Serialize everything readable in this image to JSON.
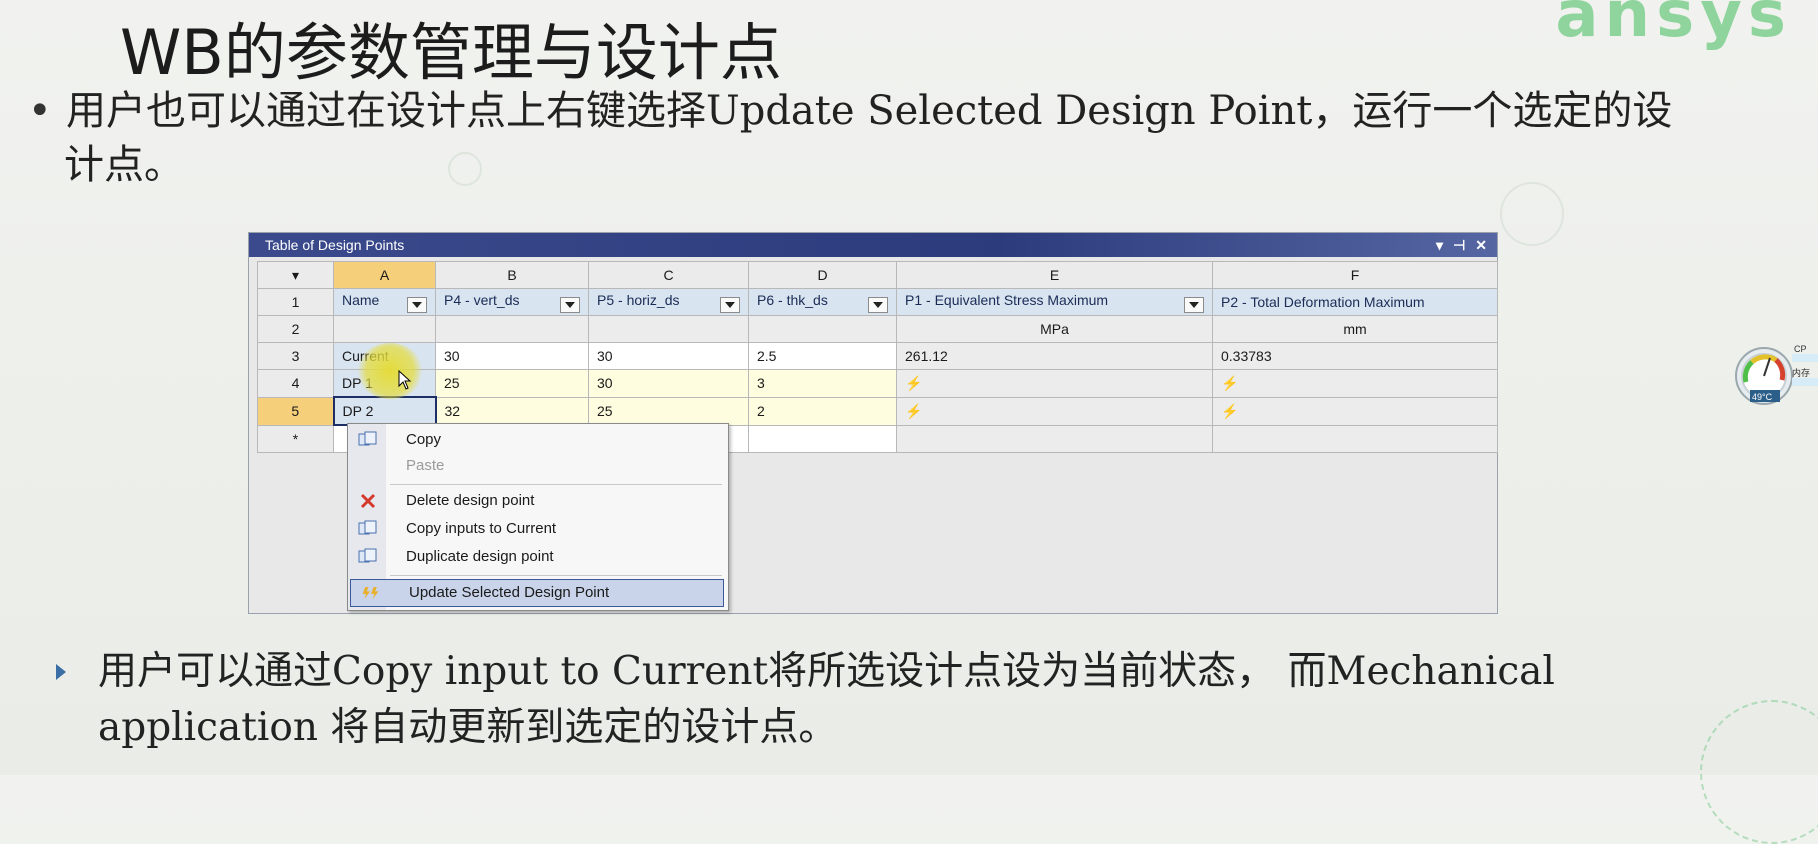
{
  "slide": {
    "logo_text": "ansys",
    "title": "WB的参数管理与设计点",
    "bullet_marker": "•",
    "bullet_line1": "用户也可以通过在设计点上右键选择Update Selected Design Point，运行一个选定的设",
    "bullet_line2": "计点。",
    "bottom_line1": "用户可以通过Copy input to Current将所选设计点设为当前状态， 而Mechanical",
    "bottom_line2": "application 将自动更新到选定的设计点。"
  },
  "window": {
    "title": "Table of Design Points",
    "controls": [
      "▾",
      "⊣",
      "✕"
    ]
  },
  "table": {
    "corner": "▾",
    "columns": [
      "A",
      "B",
      "C",
      "D",
      "E",
      "F"
    ],
    "row_numbers": [
      "1",
      "2",
      "3",
      "4",
      "5",
      "*"
    ],
    "headers": [
      "Name",
      "P4 - vert_ds",
      "P5 - horiz_ds",
      "P6 - thk_ds",
      "P1 - Equivalent Stress Maximum",
      "P2 - Total Deformation Maximum"
    ],
    "units": [
      "",
      "",
      "",
      "",
      "MPa",
      "mm"
    ],
    "rows": [
      [
        "Current",
        "30",
        "30",
        "2.5",
        "261.12",
        "0.33783"
      ],
      [
        "DP 1",
        "25",
        "30",
        "3",
        "⚡",
        "⚡"
      ],
      [
        "DP 2",
        "32",
        "25",
        "2",
        "⚡",
        "⚡"
      ]
    ]
  },
  "context_menu": {
    "items": [
      {
        "label": "Copy",
        "icon": "copy-icon",
        "disabled": false
      },
      {
        "label": "Paste",
        "icon": "paste-icon",
        "disabled": true
      },
      {
        "label": "Delete design point",
        "icon": "delete-icon",
        "disabled": false
      },
      {
        "label": "Copy inputs to Current",
        "icon": "copy-inputs-icon",
        "disabled": false
      },
      {
        "label": "Duplicate design point",
        "icon": "duplicate-icon",
        "disabled": false
      },
      {
        "label": "Update Selected Design Point",
        "icon": "update-icon",
        "disabled": false,
        "highlighted": true
      }
    ]
  },
  "widget": {
    "temperature": "49°C",
    "label_cpu": "CP",
    "label_mem": "内存"
  },
  "colors": {
    "title_bar": "#2c3b7c",
    "selected_header": "#f5cf79",
    "menu_highlight": "#c9d4ea",
    "logo": "#7fcf8f"
  }
}
